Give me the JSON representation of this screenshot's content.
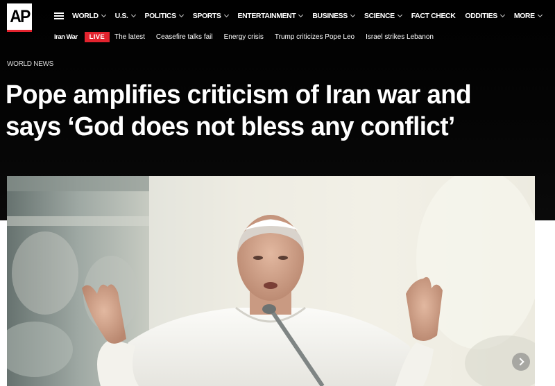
{
  "brand": {
    "logo_text": "AP"
  },
  "nav": {
    "items": [
      {
        "label": "WORLD",
        "dropdown": true
      },
      {
        "label": "U.S.",
        "dropdown": true
      },
      {
        "label": "POLITICS",
        "dropdown": true
      },
      {
        "label": "SPORTS",
        "dropdown": true
      },
      {
        "label": "ENTERTAINMENT",
        "dropdown": true
      },
      {
        "label": "BUSINESS",
        "dropdown": true
      },
      {
        "label": "SCIENCE",
        "dropdown": true
      },
      {
        "label": "FACT CHECK",
        "dropdown": false
      },
      {
        "label": "ODDITIES",
        "dropdown": true
      },
      {
        "label": "MORE",
        "dropdown": true
      }
    ]
  },
  "trending": {
    "label": "Iran War",
    "live_badge": "LIVE",
    "links": [
      "The latest",
      "Ceasefire talks fail",
      "Energy crisis",
      "Trump criticizes Pope Leo",
      "Israel strikes Lebanon"
    ]
  },
  "article": {
    "section": "WORLD NEWS",
    "headline_line1": "Pope amplifies criticism of Iran war and",
    "headline_line2": "says ‘God does not bless any conflict’"
  },
  "colors": {
    "header_bg": "#000000",
    "accent_red": "#e3232e",
    "text": "#ffffff"
  },
  "icons": {
    "menu": "hamburger-icon",
    "dropdown": "chevron-down-icon",
    "next": "chevron-right-icon"
  }
}
